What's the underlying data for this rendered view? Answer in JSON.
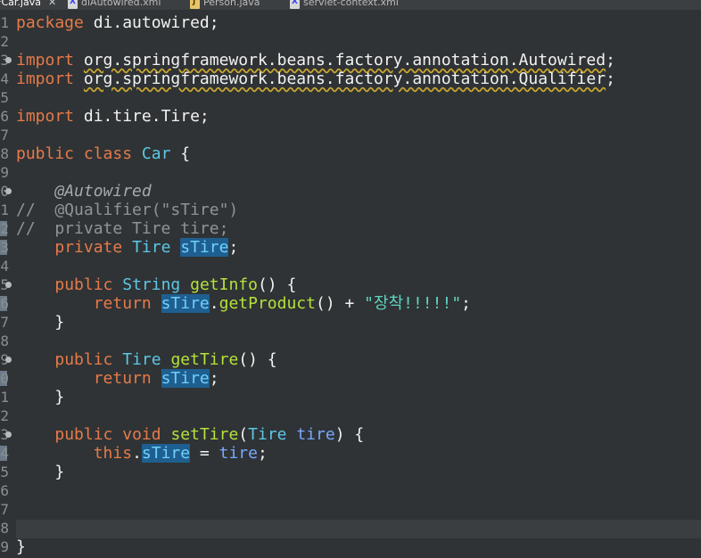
{
  "tabs": [
    {
      "label": "*Car.java",
      "kind": "java",
      "active": true,
      "closable": true
    },
    {
      "label": "diAutowired.xml",
      "kind": "xml",
      "active": false
    },
    {
      "label": "Person.java",
      "kind": "java",
      "active": false
    },
    {
      "label": "servlet-context.xml",
      "kind": "xml",
      "active": false
    }
  ],
  "editor": {
    "line_numbers": [
      "1",
      "2",
      "3",
      "4",
      "5",
      "6",
      "7",
      "8",
      "9",
      "0",
      "1",
      "2",
      "3",
      "4",
      "5",
      "6",
      "7",
      "8",
      "9",
      "0",
      "1",
      "2",
      "3",
      "4",
      "5",
      "6",
      "7",
      "8",
      "9"
    ],
    "code": {
      "l1": [
        "package",
        " di.autowired;"
      ],
      "l3": [
        "import",
        " ",
        "org.springframework.beans.factory.annotation.Autowired",
        ";"
      ],
      "l4": [
        "import",
        " ",
        "org.springframework.beans.factory.annotation.Qualifier",
        ";"
      ],
      "l6": [
        "import",
        " di.tire.Tire;"
      ],
      "l8": [
        "public",
        " ",
        "class",
        " ",
        "Car",
        " {"
      ],
      "l10": [
        "    ",
        "@Autowired"
      ],
      "l11": "//  @Qualifier(\"sTire\")",
      "l12": "//  private Tire tire;",
      "l13": [
        "    ",
        "private",
        " ",
        "Tire",
        " ",
        "sTire",
        ";"
      ],
      "l15": [
        "    ",
        "public",
        " ",
        "String",
        " ",
        "getInfo",
        "() {"
      ],
      "l16": [
        "        ",
        "return",
        " ",
        "sTire",
        ".",
        "getProduct",
        "() + ",
        "\"장착!!!!!\"",
        ";"
      ],
      "l17": "    }",
      "l19": [
        "    ",
        "public",
        " ",
        "Tire",
        " ",
        "getTire",
        "() {"
      ],
      "l20": [
        "        ",
        "return",
        " ",
        "sTire",
        ";"
      ],
      "l21": "    }",
      "l23": [
        "    ",
        "public",
        " ",
        "void",
        " ",
        "setTire",
        "(",
        "Tire",
        " ",
        "tire",
        ") {"
      ],
      "l24": [
        "        ",
        "this",
        ".",
        "sTire",
        " = ",
        "tire",
        ";"
      ],
      "l25": "    }",
      "l29": "}"
    }
  }
}
